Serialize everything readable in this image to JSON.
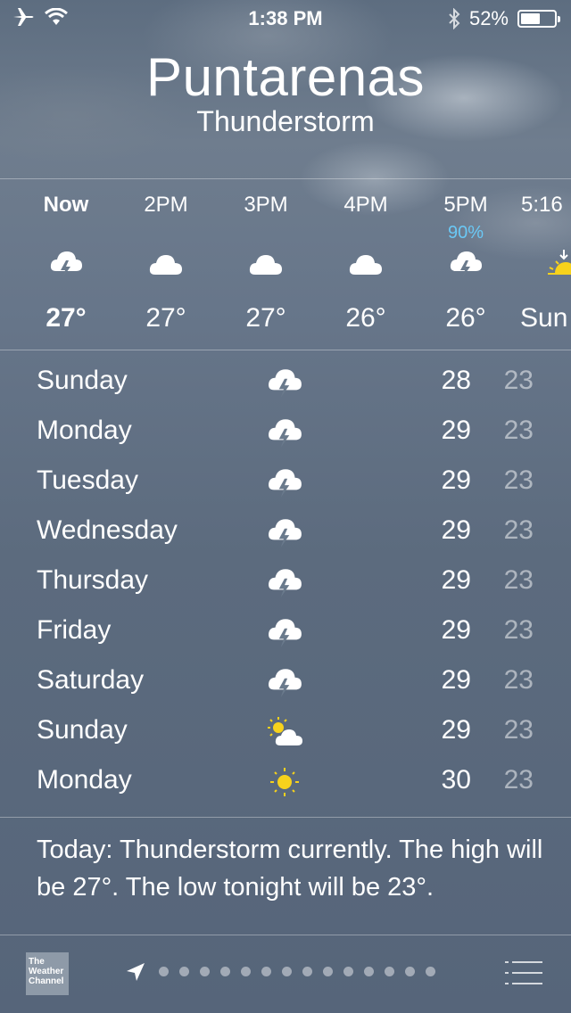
{
  "status_bar": {
    "time": "1:38 PM",
    "battery": "52%",
    "icons": [
      "airplane-icon",
      "wifi-icon",
      "bluetooth-icon",
      "battery-icon"
    ]
  },
  "location": {
    "city": "Puntarenas",
    "condition": "Thunderstorm"
  },
  "hourly": [
    {
      "label": "Now",
      "pop": "",
      "icon": "thunderstorm-icon",
      "temp": "27°"
    },
    {
      "label": "2PM",
      "pop": "",
      "icon": "cloud-icon",
      "temp": "27°"
    },
    {
      "label": "3PM",
      "pop": "",
      "icon": "cloud-icon",
      "temp": "27°"
    },
    {
      "label": "4PM",
      "pop": "",
      "icon": "cloud-icon",
      "temp": "26°"
    },
    {
      "label": "5PM",
      "pop": "90%",
      "icon": "thunderstorm-icon",
      "temp": "26°"
    },
    {
      "label": "5:16",
      "pop": "",
      "icon": "sunset-icon",
      "temp": "Sun"
    }
  ],
  "daily": [
    {
      "day": "Sunday",
      "icon": "thunderstorm-icon",
      "high": "28",
      "low": "23"
    },
    {
      "day": "Monday",
      "icon": "thunderstorm-icon",
      "high": "29",
      "low": "23"
    },
    {
      "day": "Tuesday",
      "icon": "thunderstorm-icon",
      "high": "29",
      "low": "23"
    },
    {
      "day": "Wednesday",
      "icon": "thunderstorm-icon",
      "high": "29",
      "low": "23"
    },
    {
      "day": "Thursday",
      "icon": "thunderstorm-icon",
      "high": "29",
      "low": "23"
    },
    {
      "day": "Friday",
      "icon": "thunderstorm-icon",
      "high": "29",
      "low": "23"
    },
    {
      "day": "Saturday",
      "icon": "thunderstorm-icon",
      "high": "29",
      "low": "23"
    },
    {
      "day": "Sunday",
      "icon": "partly-sunny-icon",
      "high": "29",
      "low": "23"
    },
    {
      "day": "Monday",
      "icon": "sun-icon",
      "high": "30",
      "low": "23"
    }
  ],
  "summary": "Today: Thunderstorm currently. The high will be 27°. The low tonight will be 23°.",
  "bottom_bar": {
    "logo_text": "The Weather Channel",
    "page_count": 15
  },
  "colors": {
    "precip_accent": "#6ac8f5",
    "sun_yellow": "#f7d21c"
  }
}
